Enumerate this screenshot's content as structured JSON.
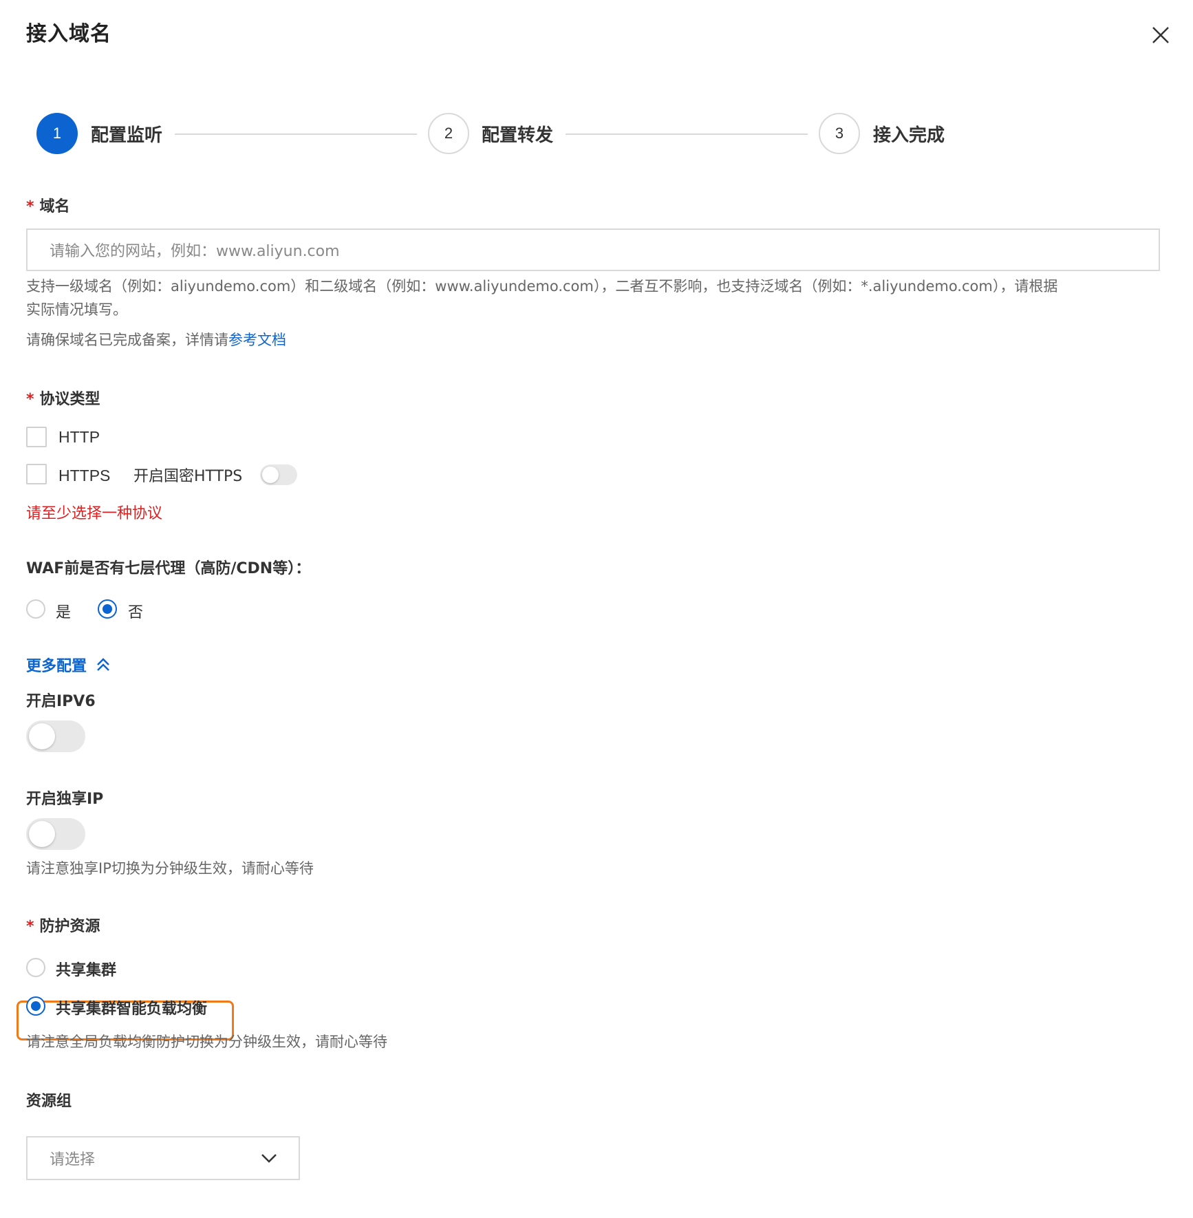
{
  "dialog": {
    "title": "接入域名"
  },
  "steps": [
    {
      "number": "1",
      "label": "配置监听",
      "state": "active"
    },
    {
      "number": "2",
      "label": "配置转发",
      "state": "pending"
    },
    {
      "number": "3",
      "label": "接入完成",
      "state": "pending"
    }
  ],
  "domain": {
    "label": "域名",
    "required_mark": "*",
    "placeholder": "请输入您的网站，例如：www.aliyun.com",
    "help_line1": "支持一级域名（例如：aliyundemo.com）和二级域名（例如：www.aliyundemo.com），二者互不影响，也支持泛域名（例如：*.aliyundemo.com），请根据",
    "help_line2": "实际情况填写。",
    "icp_text": "请确保域名已完成备案，详情请",
    "icp_link": "参考文档"
  },
  "protocol": {
    "label": "协议类型",
    "required_mark": "*",
    "http_label": "HTTP",
    "http_checked": false,
    "https_label": "HTTPS",
    "https_checked": false,
    "gm_https_label": "开启国密HTTPS",
    "gm_https_on": false,
    "error": "请至少选择一种协议"
  },
  "proxy": {
    "label": "WAF前是否有七层代理（高防/CDN等）：",
    "yes_label": "是",
    "no_label": "否",
    "selected": "否"
  },
  "more_config": {
    "label": "更多配置",
    "expanded": true
  },
  "ipv6": {
    "label": "开启IPV6",
    "on": false
  },
  "exclusive_ip": {
    "label": "开启独享IP",
    "on": false,
    "help": "请注意独享IP切换为分钟级生效，请耐心等待"
  },
  "protection": {
    "label": "防护资源",
    "required_mark": "*",
    "options": [
      "共享集群",
      "共享集群智能负载均衡"
    ],
    "selected": "共享集群智能负载均衡",
    "help": "请注意全局负载均衡防护切换为分钟级生效，请耐心等待"
  },
  "resource_group": {
    "label": "资源组",
    "placeholder": "请选择"
  },
  "colors": {
    "primary": "#0b64d0",
    "error": "#e02020",
    "highlight": "#f07a1a"
  }
}
